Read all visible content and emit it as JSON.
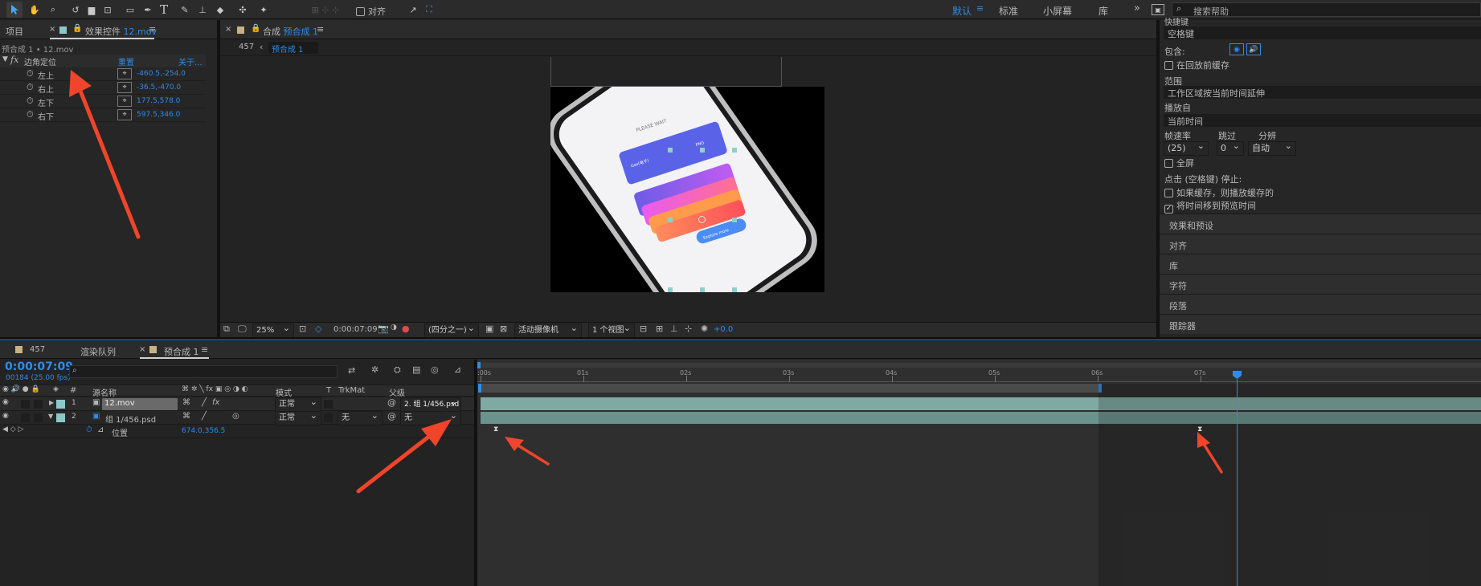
{
  "toolbar": {
    "align_label": "对齐",
    "workspaces": [
      "默认",
      "标准",
      "小屏幕",
      "库"
    ],
    "search_placeholder": "搜索帮助",
    "more": "»"
  },
  "project_panel": {
    "tab": "项目",
    "tab_effects": "效果控件",
    "tab_effects_file": "12.mov",
    "breadcrumb": "预合成 1 • 12.mov"
  },
  "effect": {
    "fx": "fx",
    "name": "边角定位",
    "reset": "重置",
    "about": "关于...",
    "params": [
      {
        "label": "左上",
        "value": "-460.5,-254.0"
      },
      {
        "label": "右上",
        "value": "-36.5,-470.0"
      },
      {
        "label": "左下",
        "value": "177.5,578.0"
      },
      {
        "label": "右下",
        "value": "597.5,346.0"
      }
    ]
  },
  "comp": {
    "tab_prefix": "合成",
    "tab_name": "预合成 1",
    "crumb_root": "457",
    "crumb_current": "预合成 1",
    "screen": {
      "title": "PLEASE WAIT",
      "card_left": "Gas(电子)",
      "card_right": "PNG",
      "button": "Explore more"
    },
    "footer": {
      "zoom": "25%",
      "time": "0:00:07:09",
      "resolution": "(四分之一)",
      "camera": "活动摄像机",
      "views": "1 个视图",
      "exposure": "+0.0"
    }
  },
  "right_panel": {
    "shortcut_header": "快捷键",
    "shortcut": "空格键",
    "include": "包含:",
    "cache_before": "在回放前缓存",
    "range": "范围",
    "range_value": "工作区域按当前时间延伸",
    "play_from": "播放自",
    "play_from_value": "当前时间",
    "fps": "帧速率",
    "skip": "跳过",
    "res": "分辨",
    "fps_value": "(25)",
    "skip_value": "0",
    "res_value": "自动",
    "fullscreen": "全屏",
    "stop_label": "点击 (空格键) 停止:",
    "if_cache": "如果缓存，则播放缓存的",
    "move_time": "将时间移到预览时间",
    "sections": [
      "效果和预设",
      "对齐",
      "库",
      "字符",
      "段落",
      "跟踪器"
    ]
  },
  "timeline": {
    "tabs": [
      "457",
      "渲染队列",
      "预合成 1"
    ],
    "timecode": "0:00:07:09",
    "frames": "00184 (25.00 fps)",
    "headers": {
      "num": "#",
      "source": "源名称",
      "mode": "模式",
      "t": "T",
      "trkmat": "TrkMat",
      "parent": "父级"
    },
    "layers": [
      {
        "num": "1",
        "name": "12.mov",
        "mode": "正常",
        "trkmat": "",
        "parent": "2. 组 1/456.psd"
      },
      {
        "num": "2",
        "name": "组 1/456.psd",
        "mode": "正常",
        "trkmat": "无",
        "parent": "无"
      }
    ],
    "property": {
      "name": "位置",
      "value": "674.0,356.5"
    },
    "ruler": [
      ":00s",
      "01s",
      "02s",
      "03s",
      "04s",
      "05s",
      "06s",
      "07s"
    ]
  },
  "colors": {
    "accent": "#2d8ceb",
    "annotation": "#f0452a",
    "layer_bar": "#7fa9a3"
  }
}
